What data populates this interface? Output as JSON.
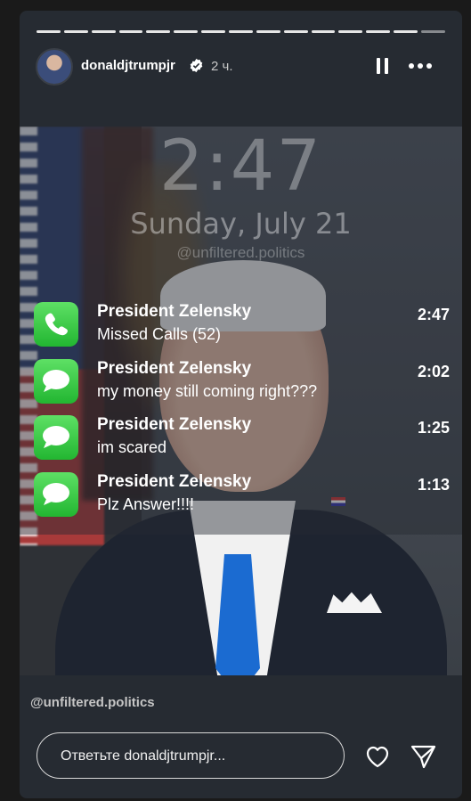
{
  "header": {
    "username": "donaldjtrumpjr",
    "time_ago": "2 ч."
  },
  "lockscreen": {
    "time": "2:47",
    "date": "Sunday, July 21",
    "watermark": "@unfiltered.politics"
  },
  "notifications": [
    {
      "app": "phone-icon",
      "title": "President Zelensky",
      "body": "Missed Calls (52)",
      "time": "2:47"
    },
    {
      "app": "messages-icon",
      "title": "President Zelensky",
      "body": "my money still coming right???",
      "time": "2:02"
    },
    {
      "app": "messages-icon",
      "title": "President Zelensky",
      "body": "im scared",
      "time": "1:25"
    },
    {
      "app": "messages-icon",
      "title": "President Zelensky",
      "body": "Plz Answer!!!!",
      "time": "1:13"
    }
  ],
  "footer": {
    "watermark": "@unfiltered.politics",
    "reply_placeholder": "Ответьте donaldjtrumpjr..."
  },
  "colors": {
    "notification_green": "#22b631",
    "tie_blue": "#1b6bd1",
    "verified_blue": "#ffffff"
  }
}
